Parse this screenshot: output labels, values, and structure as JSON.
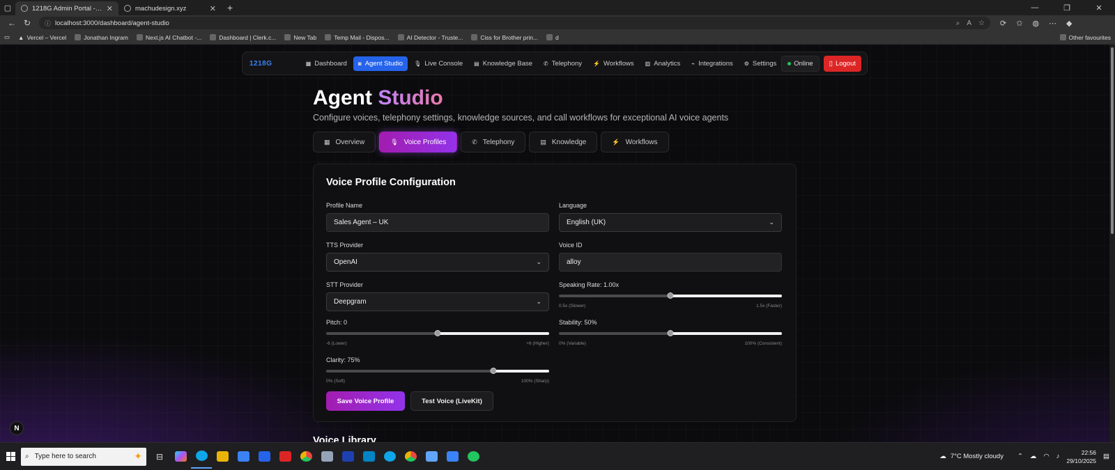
{
  "browser": {
    "tabs": [
      {
        "title": "1218G Admin Portal - AI Voice Ag",
        "active": true
      },
      {
        "title": "machudesign.xyz",
        "active": false
      }
    ],
    "url": "localhost:3000/dashboard/agent-studio",
    "bookmarks": [
      "Vercel – Vercel",
      "Jonathan Ingram",
      "Next.js AI Chatbot -...",
      "Dashboard | Clerk.c...",
      "New Tab",
      "Temp Mail - Dispos...",
      "AI Detector - Truste...",
      "Ciss for Brother prin...",
      "d"
    ],
    "other_favourites": "Other favourites"
  },
  "nav": {
    "brand": "1218G",
    "items": [
      {
        "label": "Dashboard",
        "icon": "chart-icon",
        "glyph": "▦",
        "active": false
      },
      {
        "label": "Agent Studio",
        "icon": "robot-icon",
        "glyph": "◙",
        "active": true
      },
      {
        "label": "Live Console",
        "icon": "mic-icon",
        "glyph": "🎙",
        "active": false
      },
      {
        "label": "Knowledge Base",
        "icon": "book-icon",
        "glyph": "▤",
        "active": false
      },
      {
        "label": "Telephony",
        "icon": "phone-icon",
        "glyph": "✆",
        "active": false
      },
      {
        "label": "Workflows",
        "icon": "bolt-icon",
        "glyph": "⚡",
        "active": false
      },
      {
        "label": "Analytics",
        "icon": "analytics-icon",
        "glyph": "▥",
        "active": false
      },
      {
        "label": "Integrations",
        "icon": "plug-icon",
        "glyph": "⌁",
        "active": false
      },
      {
        "label": "Settings",
        "icon": "gear-icon",
        "glyph": "⚙",
        "active": false
      }
    ],
    "status": "Online",
    "logout": "Logout"
  },
  "header": {
    "title_main": "Agent",
    "title_accent": "Studio",
    "subtitle": "Configure voices, telephony settings, knowledge sources, and call workflows for exceptional AI voice agents"
  },
  "tabs": [
    {
      "label": "Overview",
      "icon": "chart-icon",
      "glyph": "▦",
      "active": false
    },
    {
      "label": "Voice Profiles",
      "icon": "mic-icon",
      "glyph": "🎙",
      "active": true
    },
    {
      "label": "Telephony",
      "icon": "phone-icon",
      "glyph": "✆",
      "active": false
    },
    {
      "label": "Knowledge",
      "icon": "book-icon",
      "glyph": "▤",
      "active": false
    },
    {
      "label": "Workflows",
      "icon": "bolt-icon",
      "glyph": "⚡",
      "active": false
    }
  ],
  "form": {
    "heading": "Voice Profile Configuration",
    "profile_name": {
      "label": "Profile Name",
      "value": "Sales Agent – UK"
    },
    "language": {
      "label": "Language",
      "value": "English (UK)"
    },
    "tts": {
      "label": "TTS Provider",
      "value": "OpenAI"
    },
    "voice_id": {
      "label": "Voice ID",
      "value": "alloy"
    },
    "stt": {
      "label": "STT Provider",
      "value": "Deepgram"
    },
    "speaking_rate": {
      "label": "Speaking Rate: 1.00x",
      "value": 1.0,
      "min": 0.5,
      "max": 1.5,
      "min_label": "0.5x (Slower)",
      "max_label": "1.5x (Faster)"
    },
    "pitch": {
      "label": "Pitch: 0",
      "value": 0,
      "min": -6,
      "max": 6,
      "min_label": "-6 (Lower)",
      "max_label": "+6 (Higher)"
    },
    "stability": {
      "label": "Stability: 50%",
      "value": 50,
      "min": 0,
      "max": 100,
      "min_label": "0% (Variable)",
      "max_label": "100% (Consistent)"
    },
    "clarity": {
      "label": "Clarity: 75%",
      "value": 75,
      "min": 0,
      "max": 100,
      "min_label": "0% (Soft)",
      "max_label": "100% (Sharp)"
    },
    "save_label": "Save Voice Profile",
    "test_label": "Test Voice (LiveKit)"
  },
  "next_section": "Voice Library",
  "taskbar": {
    "search_placeholder": "Type here to search",
    "weather": "7°C  Mostly cloudy",
    "time": "22:56",
    "date": "29/10/2025"
  },
  "colors": {
    "accent_purple": "#9333ea",
    "accent_magenta": "#a21caf",
    "nav_active": "#2563eb",
    "logout": "#dc2626"
  }
}
